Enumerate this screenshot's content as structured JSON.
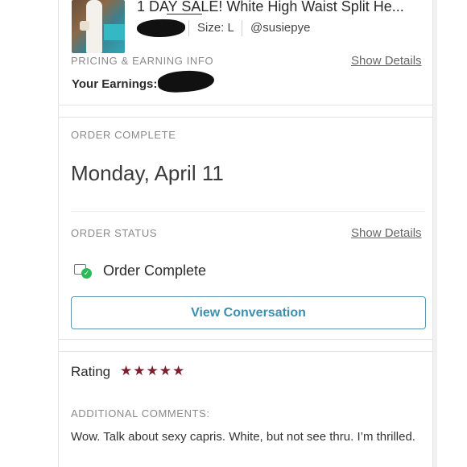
{
  "product": {
    "title": "1 DAY SALE! White High Waist Split He...",
    "size": "Size: L",
    "seller": "@susiepye"
  },
  "pricing": {
    "section_label": "PRICING & EARNING INFO",
    "details_link": "Show Details",
    "earnings_label": "Your Earnings: $"
  },
  "order_complete": {
    "section_label": "ORDER COMPLETE",
    "date": "Monday, April 11"
  },
  "order_status": {
    "section_label": "ORDER STATUS",
    "details_link": "Show Details",
    "status": "Order Complete",
    "status_color": "#2fb85a"
  },
  "conversation_button": {
    "label": "View Conversation",
    "color": "#3d8fb0"
  },
  "rating": {
    "label": "Rating",
    "stars": 5,
    "star_color": "#7a1f2e",
    "star_glyph": "★"
  },
  "comments": {
    "section_label": "ADDITIONAL COMMENTS:",
    "text": "Wow. Talk about sexy capris. White, but not see thru. I’m thrilled."
  }
}
